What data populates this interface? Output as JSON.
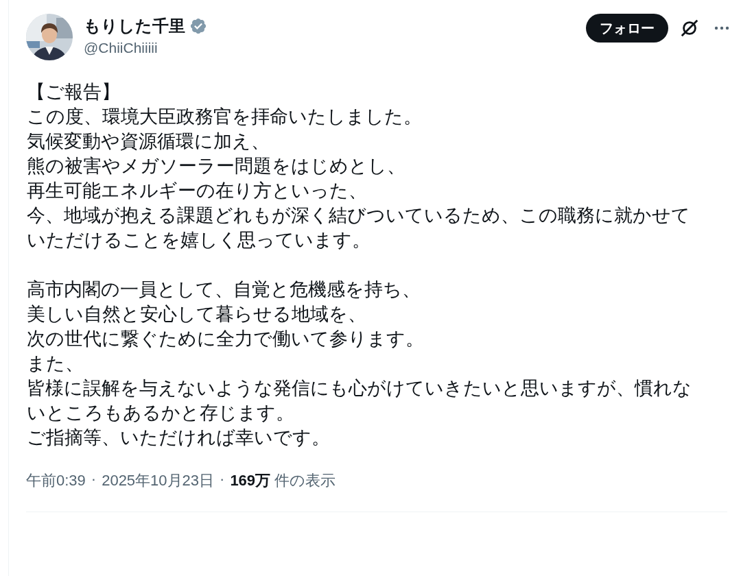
{
  "author": {
    "name": "もりした千里",
    "verified": true,
    "handle": "@ChiiChiiiii"
  },
  "follow_button": "フォロー",
  "post": {
    "paragraphs": [
      [
        "【ご報告】",
        "この度、環境大臣政務官を拝命いたしました。",
        "気候変動や資源循環に加え、",
        "熊の被害やメガソーラー問題をはじめとし、",
        "再生可能エネルギーの在り方といった、",
        "今、地域が抱える課題どれもが深く結びついているため、この職務に就かせて",
        "いただけることを嬉しく思っています。"
      ],
      [
        "高市内閣の一員として、自覚と危機感を持ち、",
        "美しい自然と安心して暮らせる地域を、",
        "次の世代に繋ぐために全力で働いて参ります。",
        "また、",
        "皆様に誤解を与えないような発信にも心がけていきたいと思いますが、慣れな",
        "いところもあるかと存じます。",
        "ご指摘等、いただければ幸いです。"
      ]
    ]
  },
  "meta": {
    "time": "午前0:39",
    "separator_1": "·",
    "date": "2025年10月23日",
    "separator_2": "·",
    "views": "**169万** 件の表示"
  }
}
